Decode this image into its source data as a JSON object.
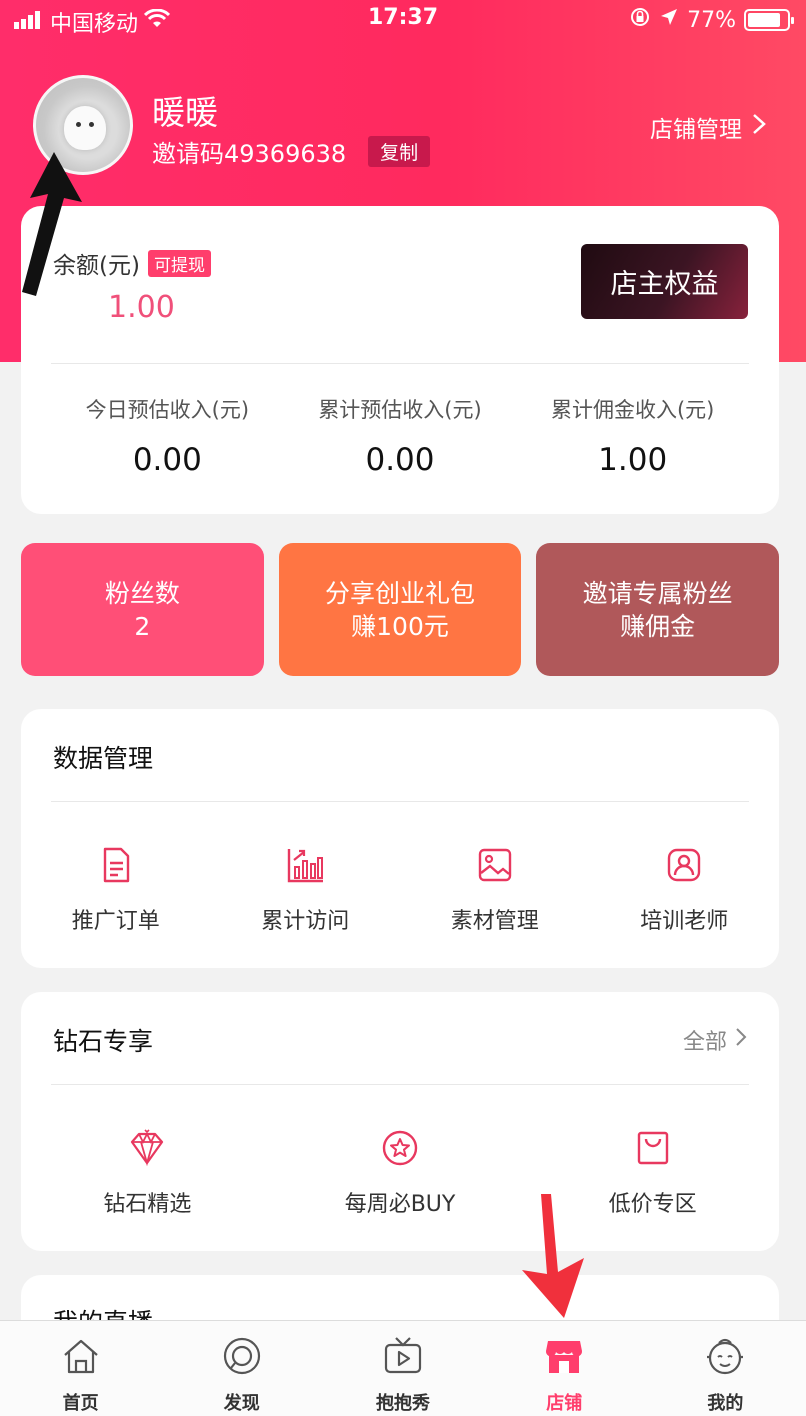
{
  "status_bar": {
    "carrier": "中国移动",
    "time": "17:37",
    "battery": "77%"
  },
  "profile": {
    "name": "暖暖",
    "invite_code": "邀请码49369638",
    "copy_label": "复制",
    "store_manage": "店铺管理"
  },
  "balance": {
    "label": "余额(元)",
    "badge": "可提现",
    "value": "1.00",
    "vip_label": "店主权益"
  },
  "stats": [
    {
      "label": "今日预估收入(元)",
      "value": "0.00"
    },
    {
      "label": "累计预估收入(元)",
      "value": "0.00"
    },
    {
      "label": "累计佣金收入(元)",
      "value": "1.00"
    }
  ],
  "tiles": [
    {
      "line1": "粉丝数",
      "line2": "2"
    },
    {
      "line1": "分享创业礼包",
      "line2": "赚100元"
    },
    {
      "line1": "邀请专属粉丝",
      "line2": "赚佣金"
    }
  ],
  "data_management": {
    "title": "数据管理",
    "items": [
      {
        "label": "推广订单",
        "icon": "document-icon"
      },
      {
        "label": "累计访问",
        "icon": "bar-chart-icon"
      },
      {
        "label": "素材管理",
        "icon": "image-icon"
      },
      {
        "label": "培训老师",
        "icon": "teacher-icon"
      }
    ]
  },
  "diamond": {
    "title": "钻石专享",
    "more": "全部",
    "items": [
      {
        "label": "钻石精选",
        "icon": "diamond-icon"
      },
      {
        "label": "每周必BUY",
        "icon": "star-circle-icon"
      },
      {
        "label": "低价专区",
        "icon": "bag-icon"
      }
    ]
  },
  "live": {
    "title": "我的直播"
  },
  "tabbar": [
    {
      "label": "首页",
      "icon": "home-icon"
    },
    {
      "label": "发现",
      "icon": "discover-icon"
    },
    {
      "label": "抱抱秀",
      "icon": "tv-play-icon"
    },
    {
      "label": "店铺",
      "icon": "store-icon",
      "active": true
    },
    {
      "label": "我的",
      "icon": "baby-face-icon"
    }
  ],
  "colors": {
    "brand": "#ff2d6a",
    "accent_pink": "#ff4f77",
    "accent_orange": "#ff7543",
    "accent_brown": "#b0585a"
  }
}
